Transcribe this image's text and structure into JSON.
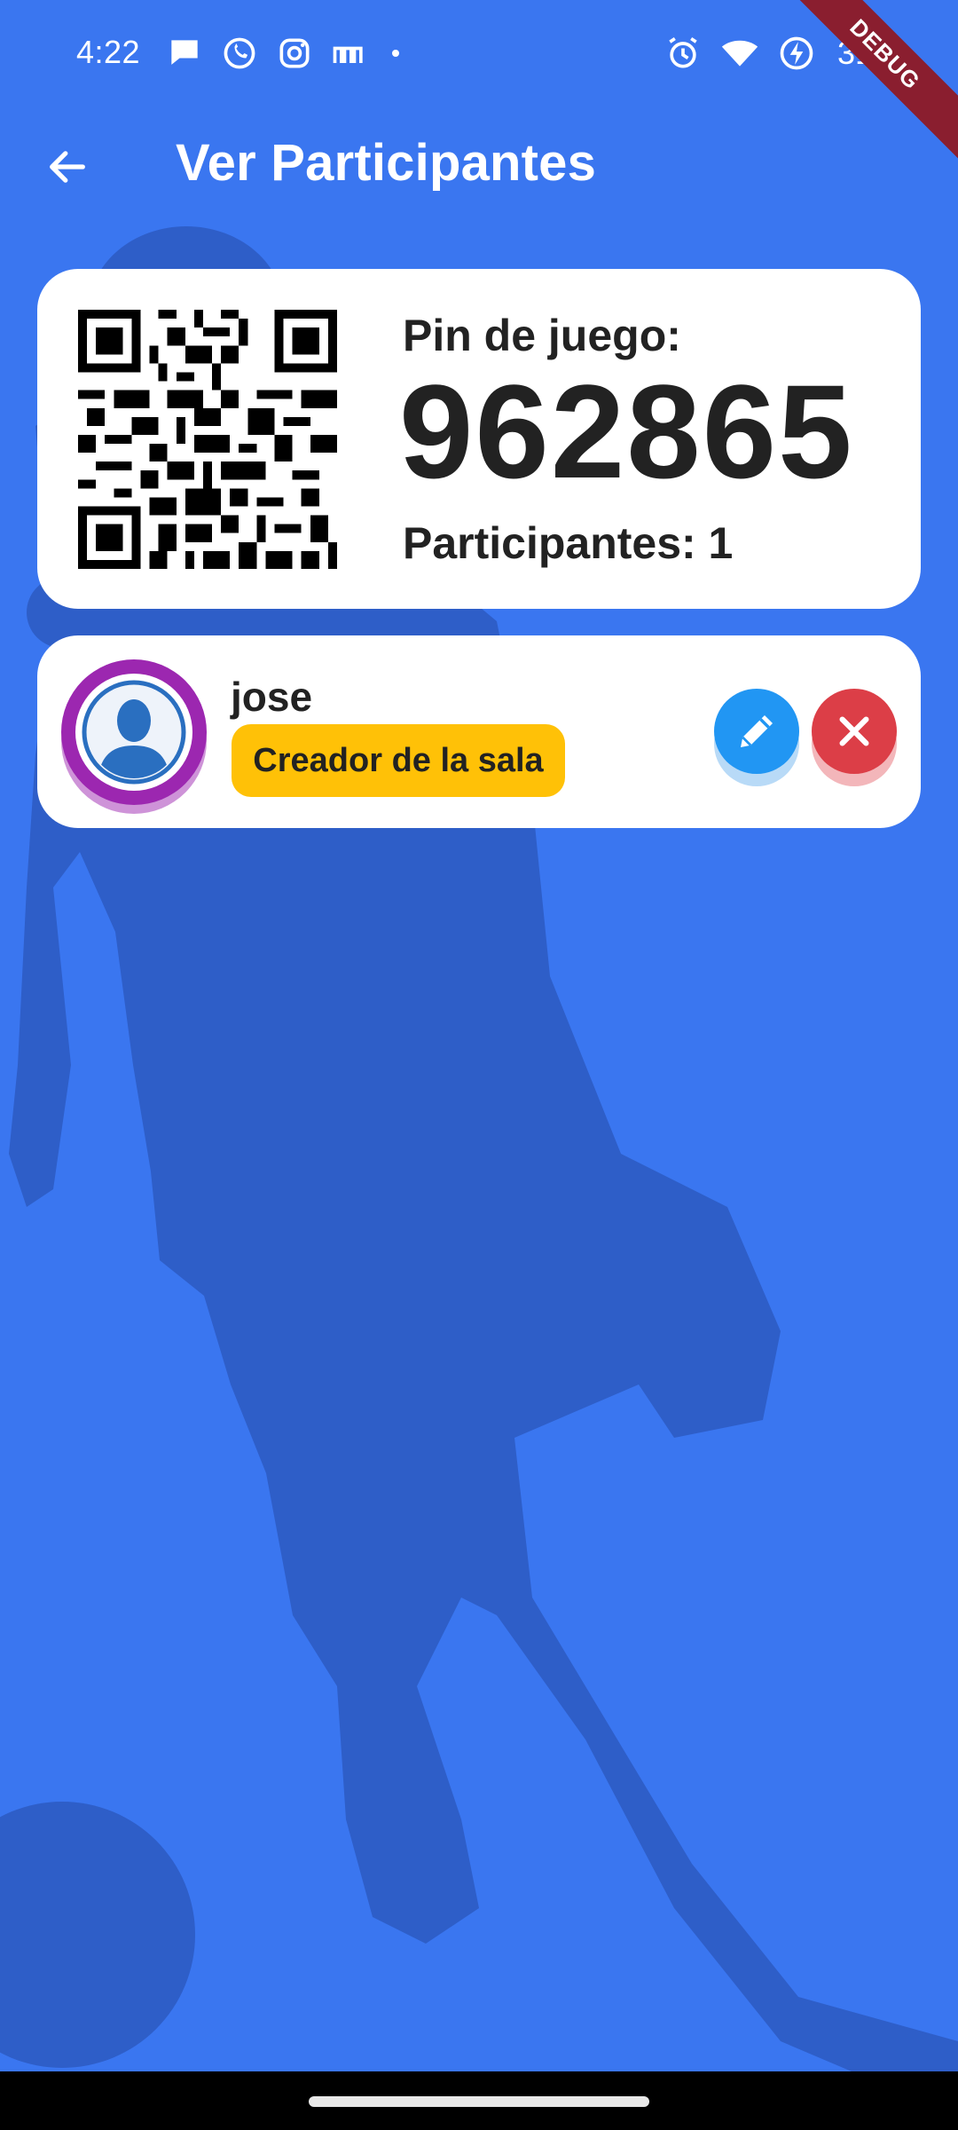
{
  "status_bar": {
    "time": "4:22",
    "battery": "31 %",
    "left_icons": [
      "message-icon",
      "whatsapp-icon",
      "instagram-icon",
      "m-app-icon",
      "dot-icon"
    ],
    "right_icons": [
      "alarm-icon",
      "wifi-icon",
      "battery-saver-icon"
    ]
  },
  "debug_banner": "DEBUG",
  "app_bar": {
    "title": "Ver Participantes",
    "back_icon": "arrow-back-icon"
  },
  "pin_card": {
    "pin_label": "Pin de juego:",
    "pin_value": "962865",
    "participants_label": "Participantes: 1"
  },
  "participants": [
    {
      "name": "jose",
      "role": "Creador de la sala",
      "avatar_icon": "person-avatar-icon",
      "actions": [
        "pencil-icon",
        "close-icon"
      ]
    }
  ],
  "colors": {
    "background": "#3a76f0",
    "silhouette": "#2e5ec8",
    "card": "#ffffff",
    "badge": "#ffc107",
    "edit": "#2196f3",
    "delete": "#dc3e47",
    "avatar_ring": "#9c27b0"
  }
}
